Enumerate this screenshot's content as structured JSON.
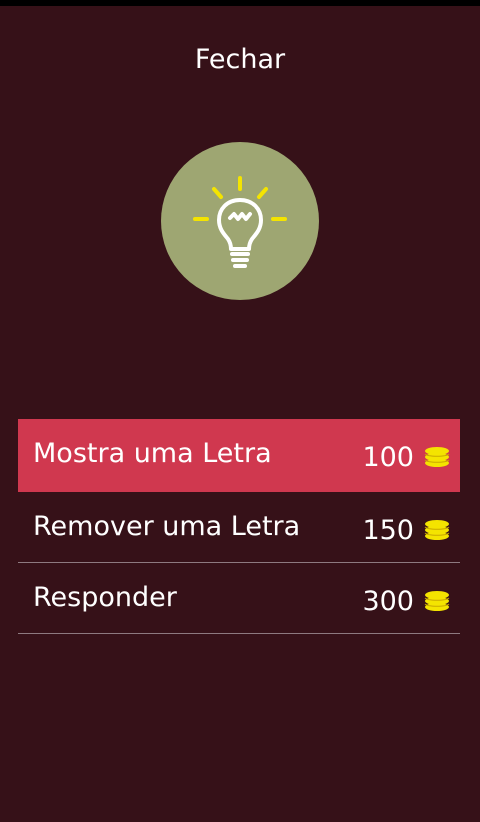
{
  "header": {
    "close_label": "Fechar"
  },
  "hint_icon": {
    "name": "lightbulb-icon",
    "circle_color": "#9ea672",
    "bulb_color": "#ffffff",
    "rays_color": "#f4e400"
  },
  "options": [
    {
      "label": "Mostra uma Letra",
      "cost": "100",
      "icon": "coins-icon",
      "highlighted": true
    },
    {
      "label": "Remover uma Letra",
      "cost": "150",
      "icon": "coins-icon",
      "highlighted": false
    },
    {
      "label": "Responder",
      "cost": "300",
      "icon": "coins-icon",
      "highlighted": false
    }
  ],
  "colors": {
    "background": "#361118",
    "highlight": "#d0384f",
    "coin": "#f4e400",
    "separator": "#8e7a80"
  }
}
